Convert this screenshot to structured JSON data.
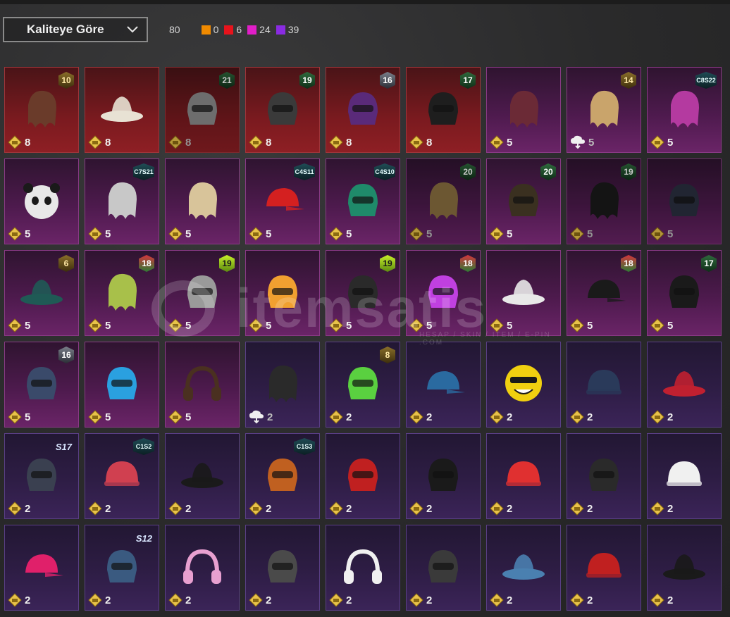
{
  "sort": {
    "label": "Kaliteye Göre"
  },
  "summary": {
    "total": "80",
    "quality_counts": [
      {
        "color": "#f08a00",
        "value": "0"
      },
      {
        "color": "#e8131c",
        "value": "6"
      },
      {
        "color": "#e11ec8",
        "value": "24"
      },
      {
        "color": "#8a2be2",
        "value": "39"
      }
    ]
  },
  "watermark": {
    "text": "itemsatis",
    "sub": "HESAP / SKIN / ITEM / E-PIN .COM"
  },
  "items": [
    {
      "quality": "red",
      "badge": "10",
      "badge_style": "gold",
      "bp": "8",
      "icon": "hair-icon",
      "art": "#6a3b2a"
    },
    {
      "quality": "red",
      "badge": "",
      "badge_style": "",
      "bp": "8",
      "icon": "cowboy-hat-icon",
      "art": "#e8e2d4"
    },
    {
      "quality": "red",
      "badge": "21",
      "badge_style": "green",
      "bp": "8",
      "icon": "mask-icon",
      "art": "#8c8c8c",
      "dark": true
    },
    {
      "quality": "red",
      "badge": "19",
      "badge_style": "green",
      "bp": "8",
      "icon": "helmet-icon",
      "art": "#3a3a3a"
    },
    {
      "quality": "red",
      "badge": "16",
      "badge_style": "silver",
      "bp": "8",
      "icon": "helmet-icon",
      "art": "#5a2a7a"
    },
    {
      "quality": "red",
      "badge": "17",
      "badge_style": "green",
      "bp": "8",
      "icon": "mask-icon",
      "art": "#1e1e1e"
    },
    {
      "quality": "pink",
      "badge": "",
      "badge_style": "",
      "bp": "5",
      "icon": "hair-icon",
      "art": "#6b2a36"
    },
    {
      "quality": "pink",
      "badge": "14",
      "badge_style": "gold",
      "bp": "5",
      "icon": "hair-icon",
      "art": "#c9a46b",
      "cloud": true
    },
    {
      "quality": "pink",
      "badge": "C8S22",
      "badge_style": "teal",
      "bp": "5",
      "icon": "hair-icon",
      "art": "#b43aa0"
    },
    {
      "quality": "pink",
      "badge": "",
      "badge_style": "",
      "bp": "5",
      "icon": "panda-mask-icon",
      "art": "#e8e8e8"
    },
    {
      "quality": "pink",
      "badge": "C7S21",
      "badge_style": "teal",
      "bp": "5",
      "icon": "hair-icon",
      "art": "#c8c8c8"
    },
    {
      "quality": "pink",
      "badge": "",
      "badge_style": "",
      "bp": "5",
      "icon": "hair-icon",
      "art": "#d8c49a"
    },
    {
      "quality": "pink",
      "badge": "C4S11",
      "badge_style": "teal",
      "bp": "5",
      "icon": "cap-icon",
      "art": "#d42020"
    },
    {
      "quality": "pink",
      "badge": "C4S10",
      "badge_style": "teal",
      "bp": "5",
      "icon": "helmet-icon",
      "art": "#1f8a6a"
    },
    {
      "quality": "pink",
      "badge": "20",
      "badge_style": "green",
      "bp": "5",
      "icon": "hair-icon",
      "art": "#8a7040",
      "dark": true
    },
    {
      "quality": "pink",
      "badge": "20",
      "badge_style": "green",
      "bp": "5",
      "icon": "mask-icon",
      "art": "#3a3020"
    },
    {
      "quality": "pink",
      "badge": "19",
      "badge_style": "green",
      "bp": "5",
      "icon": "hair-icon",
      "art": "#1a1a1a",
      "dark": true
    },
    {
      "quality": "pink",
      "badge": "",
      "badge_style": "",
      "bp": "5",
      "icon": "helmet-icon",
      "art": "#2a3040",
      "dark": true
    },
    {
      "quality": "pink",
      "badge": "6",
      "badge_style": "gold",
      "bp": "5",
      "icon": "tree-hat-icon",
      "art": "#1f5a55"
    },
    {
      "quality": "pink",
      "badge": "18",
      "badge_style": "red",
      "bp": "5",
      "icon": "hair-icon",
      "art": "#a8c04a"
    },
    {
      "quality": "pink",
      "badge": "19",
      "badge_style": "lime",
      "bp": "5",
      "icon": "cat-ears-icon",
      "art": "#9a9a9a"
    },
    {
      "quality": "pink",
      "badge": "",
      "badge_style": "",
      "bp": "5",
      "icon": "fox-helmet-icon",
      "art": "#f0a030"
    },
    {
      "quality": "pink",
      "badge": "19",
      "badge_style": "lime",
      "bp": "5",
      "icon": "goggles-helmet-icon",
      "art": "#2a2a2a"
    },
    {
      "quality": "pink",
      "badge": "18",
      "badge_style": "red",
      "bp": "5",
      "icon": "helmet-icon",
      "art": "#c040e0"
    },
    {
      "quality": "pink",
      "badge": "",
      "badge_style": "",
      "bp": "5",
      "icon": "hat-icon",
      "art": "#e8e8e8"
    },
    {
      "quality": "pink",
      "badge": "18",
      "badge_style": "red",
      "bp": "5",
      "icon": "cap-icon",
      "art": "#1a1a1a"
    },
    {
      "quality": "pink",
      "badge": "17",
      "badge_style": "green",
      "bp": "5",
      "icon": "helmet-icon",
      "art": "#1a1a1a"
    },
    {
      "quality": "pink",
      "badge": "16",
      "badge_style": "silver",
      "bp": "5",
      "icon": "helmet-icon",
      "art": "#3a4a6a"
    },
    {
      "quality": "pink",
      "badge": "",
      "badge_style": "",
      "bp": "5",
      "icon": "mask-icon",
      "art": "#2aa0e0"
    },
    {
      "quality": "pink",
      "badge": "",
      "badge_style": "",
      "bp": "5",
      "icon": "headband-icon",
      "art": "#4a3020"
    },
    {
      "quality": "purple",
      "badge": "",
      "badge_style": "",
      "bp": "2",
      "icon": "hair-icon",
      "art": "#2a2a2a",
      "cloud": true
    },
    {
      "quality": "purple",
      "badge": "8",
      "badge_style": "gold",
      "bp": "2",
      "icon": "mask-icon",
      "art": "#5ad040"
    },
    {
      "quality": "purple",
      "badge": "",
      "badge_style": "",
      "bp": "2",
      "icon": "cap-icon",
      "art": "#2a6aa0"
    },
    {
      "quality": "purple",
      "badge": "",
      "badge_style": "",
      "bp": "2",
      "icon": "emoji-mask-icon",
      "art": "#f0d010"
    },
    {
      "quality": "purple",
      "badge": "",
      "badge_style": "",
      "bp": "2",
      "icon": "beanie-icon",
      "art": "#2a3a5a"
    },
    {
      "quality": "purple",
      "badge": "",
      "badge_style": "",
      "bp": "2",
      "icon": "hat-icon",
      "art": "#c02030"
    },
    {
      "quality": "purple",
      "badge": "S17",
      "badge_style": "season",
      "bp": "2",
      "icon": "helmet-icon",
      "art": "#3a4050"
    },
    {
      "quality": "purple",
      "badge": "C1S2",
      "badge_style": "teal",
      "bp": "2",
      "icon": "beanie-icon",
      "art": "#d04050"
    },
    {
      "quality": "purple",
      "badge": "",
      "badge_style": "",
      "bp": "2",
      "icon": "witch-hat-icon",
      "art": "#1a1a1a"
    },
    {
      "quality": "purple",
      "badge": "C1S3",
      "badge_style": "teal",
      "bp": "2",
      "icon": "helmet-icon",
      "art": "#c06020"
    },
    {
      "quality": "purple",
      "badge": "",
      "badge_style": "",
      "bp": "2",
      "icon": "football-helmet-icon",
      "art": "#c02020"
    },
    {
      "quality": "purple",
      "badge": "",
      "badge_style": "",
      "bp": "2",
      "icon": "fedora-icon",
      "art": "#1a1a1a"
    },
    {
      "quality": "purple",
      "badge": "",
      "badge_style": "",
      "bp": "2",
      "icon": "beanie-icon",
      "art": "#e03030"
    },
    {
      "quality": "purple",
      "badge": "",
      "badge_style": "",
      "bp": "2",
      "icon": "helmet-icon",
      "art": "#2a2a2a"
    },
    {
      "quality": "purple",
      "badge": "",
      "badge_style": "",
      "bp": "2",
      "icon": "beanie-icon",
      "art": "#f0f0f0"
    },
    {
      "quality": "purple",
      "badge": "",
      "badge_style": "",
      "bp": "2",
      "icon": "cap-icon",
      "art": "#e0206a"
    },
    {
      "quality": "purple",
      "badge": "S12",
      "badge_style": "season",
      "bp": "2",
      "icon": "helmet-icon",
      "art": "#3a5a80"
    },
    {
      "quality": "purple",
      "badge": "",
      "badge_style": "",
      "bp": "2",
      "icon": "cat-headphones-icon",
      "art": "#e8a0d0"
    },
    {
      "quality": "purple",
      "badge": "",
      "badge_style": "",
      "bp": "2",
      "icon": "helmet-icon",
      "art": "#4a4a4a"
    },
    {
      "quality": "purple",
      "badge": "",
      "badge_style": "",
      "bp": "2",
      "icon": "cat-headphones-icon",
      "art": "#f0f0f0"
    },
    {
      "quality": "purple",
      "badge": "",
      "badge_style": "",
      "bp": "2",
      "icon": "mask-icon",
      "art": "#3a3a3a"
    },
    {
      "quality": "purple",
      "badge": "",
      "badge_style": "",
      "bp": "2",
      "icon": "shark-hat-icon",
      "art": "#4a80b0"
    },
    {
      "quality": "purple",
      "badge": "",
      "badge_style": "",
      "bp": "2",
      "icon": "beret-icon",
      "art": "#c02020"
    },
    {
      "quality": "purple",
      "badge": "",
      "badge_style": "",
      "bp": "2",
      "icon": "top-hat-icon",
      "art": "#1a1a1a"
    }
  ]
}
